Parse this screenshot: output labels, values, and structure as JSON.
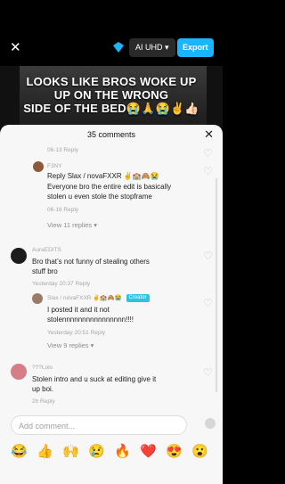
{
  "top": {
    "quality": "AI UHD ▾",
    "export": "Export"
  },
  "video": {
    "caption": "LOOKS LIKE BROS WOKE UP\nUP ON THE WRONG\nSIDE OF THE BED😭🙏😭✌️👍🏻"
  },
  "sheet": {
    "title": "35 comments"
  },
  "comments": [
    {
      "meta_top": "06-13   Reply",
      "user": "F3NY",
      "reply_prefix": "Reply",
      "reply_target": "Slax / novaFXXR",
      "badges": "✌️🏫🙈😭",
      "text_1": "Everyone bro the entire edit is basically",
      "text_2": "stolen u even stole the stopframe",
      "meta": "06-16   Reply",
      "replies_toggle": "View 11 replies ▾"
    },
    {
      "user": "AuraEDITS",
      "text_1": "Bro that’s not funny of stealing others",
      "text_2": "stuff bro",
      "meta": "Yesterday 20:37   Reply"
    },
    {
      "user": "Slax / novaFXXR",
      "badges": "✌️🏫🙈😭",
      "badge_text": "Creator",
      "text_1": "I posted it and it not",
      "text_2": "stolennnnnnnnnnnnnnnn!!!!",
      "meta": "Yesterday 20:51   Reply",
      "replies_toggle": "View 9 replies ▾"
    },
    {
      "user": "???Lolo",
      "text_1": "Stolen intro and u suck at editing give it",
      "text_2": "up boi.",
      "meta": "2h   Reply"
    }
  ],
  "input": {
    "placeholder": "Add comment..."
  },
  "emojis": [
    "😂",
    "👍",
    "🙌",
    "😢",
    "🔥",
    "❤️",
    "😍",
    "😮"
  ]
}
